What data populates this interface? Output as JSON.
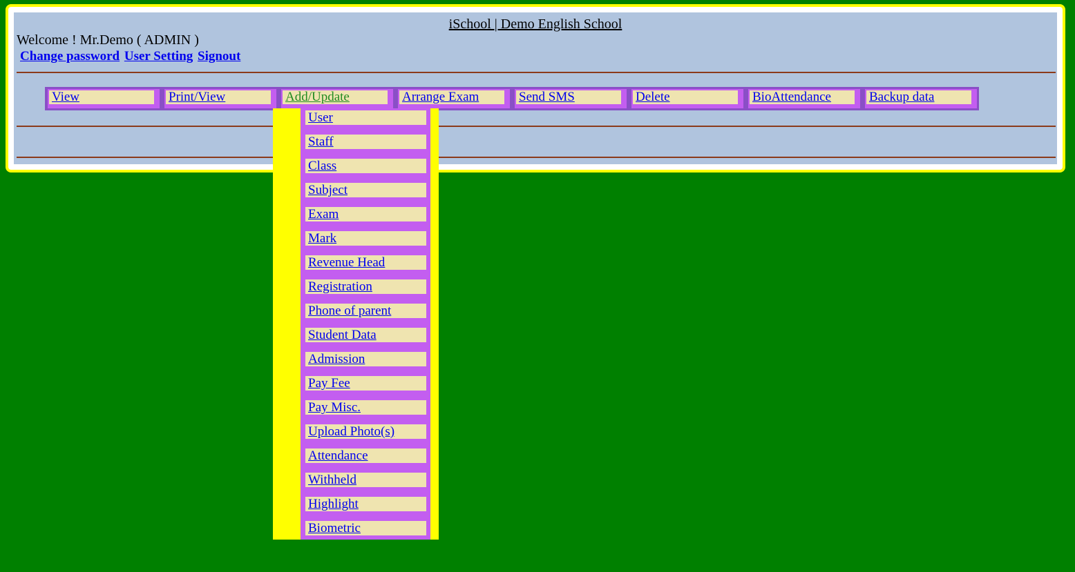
{
  "header": {
    "title": "iSchool | Demo English School",
    "welcome": "Welcome ! Mr.Demo ( ADMIN )",
    "links": [
      "Change password",
      "User Setting",
      "Signout"
    ]
  },
  "menu": {
    "items": [
      "View",
      "Print/View",
      "Add/Update",
      "Arrange Exam",
      "Send SMS",
      "Delete",
      "BioAttendance",
      "Backup data"
    ],
    "active": "Add/Update"
  },
  "dropdown": {
    "items": [
      "User",
      "Staff",
      "Class",
      "Subject",
      "Exam",
      "Mark",
      "Revenue Head",
      "Registration",
      "Phone of parent",
      "Student Data",
      "Admission",
      "Pay Fee",
      "Pay Misc.",
      "Upload Photo(s)",
      "Attendance",
      "Withheld",
      "Highlight",
      "Biometric"
    ]
  },
  "colors": {
    "background": "#008000",
    "frame_border": "#ffff00",
    "panel": "#b0c4de",
    "menu_bg": "#c35ef0",
    "menu_item": "#efe4b0",
    "link": "#0000ee",
    "active_link": "#228b22"
  }
}
